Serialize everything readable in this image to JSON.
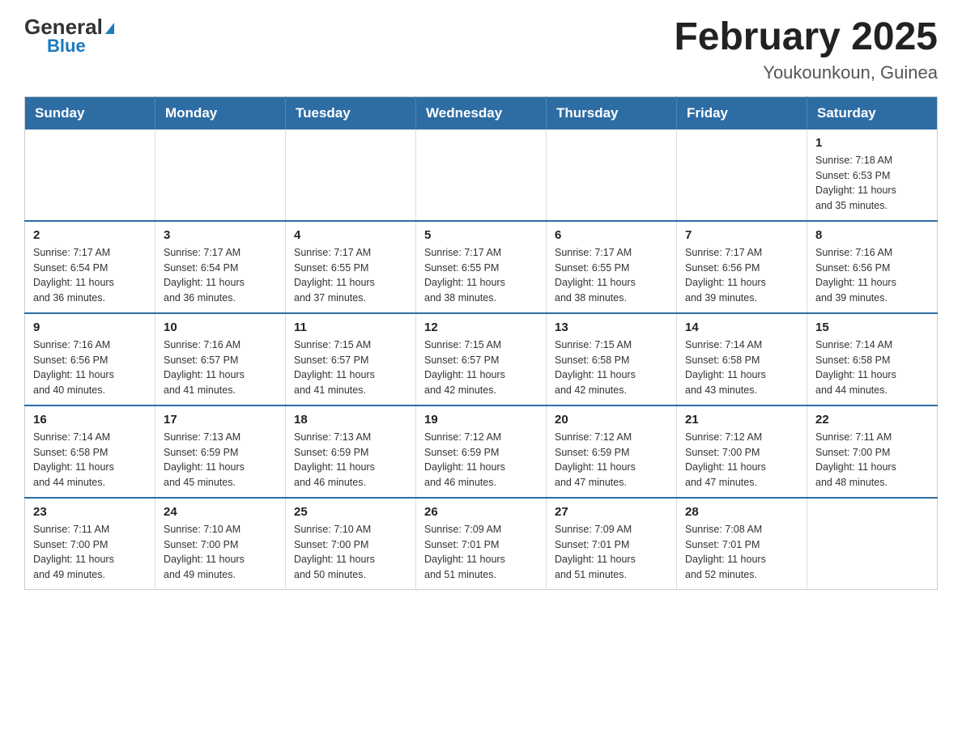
{
  "header": {
    "logo_general": "General",
    "logo_blue": "Blue",
    "title": "February 2025",
    "subtitle": "Youkounkoun, Guinea"
  },
  "calendar": {
    "days_of_week": [
      "Sunday",
      "Monday",
      "Tuesday",
      "Wednesday",
      "Thursday",
      "Friday",
      "Saturday"
    ],
    "weeks": [
      [
        {
          "day": "",
          "info": ""
        },
        {
          "day": "",
          "info": ""
        },
        {
          "day": "",
          "info": ""
        },
        {
          "day": "",
          "info": ""
        },
        {
          "day": "",
          "info": ""
        },
        {
          "day": "",
          "info": ""
        },
        {
          "day": "1",
          "info": "Sunrise: 7:18 AM\nSunset: 6:53 PM\nDaylight: 11 hours\nand 35 minutes."
        }
      ],
      [
        {
          "day": "2",
          "info": "Sunrise: 7:17 AM\nSunset: 6:54 PM\nDaylight: 11 hours\nand 36 minutes."
        },
        {
          "day": "3",
          "info": "Sunrise: 7:17 AM\nSunset: 6:54 PM\nDaylight: 11 hours\nand 36 minutes."
        },
        {
          "day": "4",
          "info": "Sunrise: 7:17 AM\nSunset: 6:55 PM\nDaylight: 11 hours\nand 37 minutes."
        },
        {
          "day": "5",
          "info": "Sunrise: 7:17 AM\nSunset: 6:55 PM\nDaylight: 11 hours\nand 38 minutes."
        },
        {
          "day": "6",
          "info": "Sunrise: 7:17 AM\nSunset: 6:55 PM\nDaylight: 11 hours\nand 38 minutes."
        },
        {
          "day": "7",
          "info": "Sunrise: 7:17 AM\nSunset: 6:56 PM\nDaylight: 11 hours\nand 39 minutes."
        },
        {
          "day": "8",
          "info": "Sunrise: 7:16 AM\nSunset: 6:56 PM\nDaylight: 11 hours\nand 39 minutes."
        }
      ],
      [
        {
          "day": "9",
          "info": "Sunrise: 7:16 AM\nSunset: 6:56 PM\nDaylight: 11 hours\nand 40 minutes."
        },
        {
          "day": "10",
          "info": "Sunrise: 7:16 AM\nSunset: 6:57 PM\nDaylight: 11 hours\nand 41 minutes."
        },
        {
          "day": "11",
          "info": "Sunrise: 7:15 AM\nSunset: 6:57 PM\nDaylight: 11 hours\nand 41 minutes."
        },
        {
          "day": "12",
          "info": "Sunrise: 7:15 AM\nSunset: 6:57 PM\nDaylight: 11 hours\nand 42 minutes."
        },
        {
          "day": "13",
          "info": "Sunrise: 7:15 AM\nSunset: 6:58 PM\nDaylight: 11 hours\nand 42 minutes."
        },
        {
          "day": "14",
          "info": "Sunrise: 7:14 AM\nSunset: 6:58 PM\nDaylight: 11 hours\nand 43 minutes."
        },
        {
          "day": "15",
          "info": "Sunrise: 7:14 AM\nSunset: 6:58 PM\nDaylight: 11 hours\nand 44 minutes."
        }
      ],
      [
        {
          "day": "16",
          "info": "Sunrise: 7:14 AM\nSunset: 6:58 PM\nDaylight: 11 hours\nand 44 minutes."
        },
        {
          "day": "17",
          "info": "Sunrise: 7:13 AM\nSunset: 6:59 PM\nDaylight: 11 hours\nand 45 minutes."
        },
        {
          "day": "18",
          "info": "Sunrise: 7:13 AM\nSunset: 6:59 PM\nDaylight: 11 hours\nand 46 minutes."
        },
        {
          "day": "19",
          "info": "Sunrise: 7:12 AM\nSunset: 6:59 PM\nDaylight: 11 hours\nand 46 minutes."
        },
        {
          "day": "20",
          "info": "Sunrise: 7:12 AM\nSunset: 6:59 PM\nDaylight: 11 hours\nand 47 minutes."
        },
        {
          "day": "21",
          "info": "Sunrise: 7:12 AM\nSunset: 7:00 PM\nDaylight: 11 hours\nand 47 minutes."
        },
        {
          "day": "22",
          "info": "Sunrise: 7:11 AM\nSunset: 7:00 PM\nDaylight: 11 hours\nand 48 minutes."
        }
      ],
      [
        {
          "day": "23",
          "info": "Sunrise: 7:11 AM\nSunset: 7:00 PM\nDaylight: 11 hours\nand 49 minutes."
        },
        {
          "day": "24",
          "info": "Sunrise: 7:10 AM\nSunset: 7:00 PM\nDaylight: 11 hours\nand 49 minutes."
        },
        {
          "day": "25",
          "info": "Sunrise: 7:10 AM\nSunset: 7:00 PM\nDaylight: 11 hours\nand 50 minutes."
        },
        {
          "day": "26",
          "info": "Sunrise: 7:09 AM\nSunset: 7:01 PM\nDaylight: 11 hours\nand 51 minutes."
        },
        {
          "day": "27",
          "info": "Sunrise: 7:09 AM\nSunset: 7:01 PM\nDaylight: 11 hours\nand 51 minutes."
        },
        {
          "day": "28",
          "info": "Sunrise: 7:08 AM\nSunset: 7:01 PM\nDaylight: 11 hours\nand 52 minutes."
        },
        {
          "day": "",
          "info": ""
        }
      ]
    ]
  }
}
